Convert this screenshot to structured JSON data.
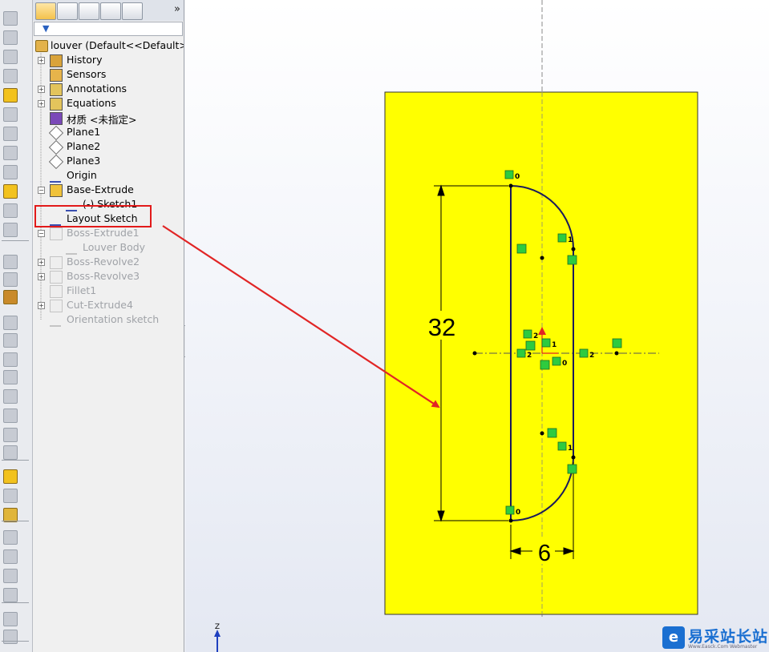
{
  "app": {
    "document_title": "louver  (Default<<Default>_"
  },
  "panel_tabs": [
    {
      "name": "feature-manager",
      "icon": "feature-tree-icon",
      "active": true
    },
    {
      "name": "property-manager",
      "icon": "property-icon",
      "active": false
    },
    {
      "name": "configuration-manager",
      "icon": "configuration-icon",
      "active": false
    },
    {
      "name": "dimxpert-manager",
      "icon": "dimxpert-icon",
      "active": false
    },
    {
      "name": "display-manager",
      "icon": "appearance-icon",
      "active": false
    }
  ],
  "more_tabs_label": "»",
  "filter_icon": "▼",
  "tree": [
    {
      "label": "History",
      "icon": "history-icon",
      "expandable": true,
      "suppressed": false
    },
    {
      "label": "Sensors",
      "icon": "sensors-icon",
      "expandable": false,
      "suppressed": false
    },
    {
      "label": "Annotations",
      "icon": "annotations-icon",
      "expandable": true,
      "suppressed": false
    },
    {
      "label": "Equations",
      "icon": "equations-icon",
      "expandable": true,
      "suppressed": false
    },
    {
      "label": "材质 <未指定>",
      "icon": "material-icon",
      "expandable": false,
      "suppressed": false
    },
    {
      "label": "Plane1",
      "icon": "plane-icon",
      "expandable": false,
      "suppressed": false
    },
    {
      "label": "Plane2",
      "icon": "plane-icon",
      "expandable": false,
      "suppressed": false
    },
    {
      "label": "Plane3",
      "icon": "plane-icon",
      "expandable": false,
      "suppressed": false
    },
    {
      "label": "Origin",
      "icon": "origin-icon",
      "expandable": false,
      "suppressed": false
    },
    {
      "label": "Base-Extrude",
      "icon": "extrude-icon",
      "expandable": true,
      "expanded": true,
      "suppressed": false
    },
    {
      "label": "(-) Sketch1",
      "icon": "sketch-icon",
      "expandable": false,
      "suppressed": false,
      "child": true
    },
    {
      "label": "Layout Sketch",
      "icon": "sketch-icon",
      "expandable": false,
      "suppressed": false,
      "highlighted": true
    },
    {
      "label": "Boss-Extrude1",
      "icon": "extrude-icon",
      "expandable": true,
      "expanded": true,
      "suppressed": true
    },
    {
      "label": "Louver Body",
      "icon": "sketch-icon",
      "expandable": false,
      "suppressed": true,
      "child": true
    },
    {
      "label": "Boss-Revolve2",
      "icon": "revolve-icon",
      "expandable": true,
      "suppressed": true
    },
    {
      "label": "Boss-Revolve3",
      "icon": "revolve-icon",
      "expandable": true,
      "suppressed": true
    },
    {
      "label": "Fillet1",
      "icon": "fillet-icon",
      "expandable": false,
      "suppressed": true
    },
    {
      "label": "Cut-Extrude4",
      "icon": "cut-extrude-icon",
      "expandable": true,
      "suppressed": true
    },
    {
      "label": "Orientation sketch",
      "icon": "sketch-icon",
      "expandable": false,
      "suppressed": true
    }
  ],
  "sketch": {
    "dimension_vertical": "32",
    "dimension_horizontal": "6",
    "relation_labels": [
      "0",
      "1",
      "2",
      "1",
      "2",
      "0",
      "2",
      "1",
      "0"
    ],
    "face_color": "#ffff00",
    "relation_color": "#2ecb3f",
    "annotation_arrow_color": "#e12525"
  },
  "triad": {
    "axis_label": "Z"
  },
  "watermark": {
    "title": "易采站长站",
    "subtitle": "Www.Easck.Com  Webmaster",
    "logo_glyph": "e"
  }
}
